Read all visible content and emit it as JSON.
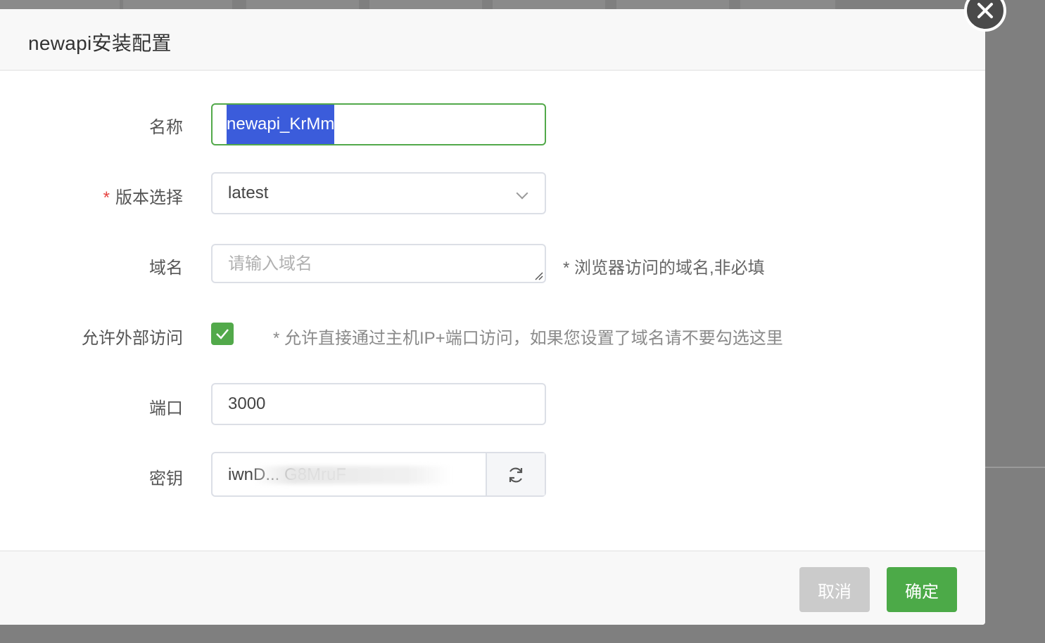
{
  "dialog": {
    "title": "newapi安装配置"
  },
  "form": {
    "name": {
      "label": "名称",
      "value": "newapi_KrMm"
    },
    "version": {
      "label": "版本选择",
      "required_mark": "*",
      "value": "latest"
    },
    "domain": {
      "label": "域名",
      "placeholder": "请输入域名",
      "hint": "* 浏览器访问的域名,非必填"
    },
    "external_access": {
      "label": "允许外部访问",
      "checked": true,
      "hint": "* 允许直接通过主机IP+端口访问，如果您设置了域名请不要勾选这里"
    },
    "port": {
      "label": "端口",
      "value": "3000"
    },
    "secret": {
      "label": "密钥",
      "value": "iwnD... G8MruF"
    }
  },
  "footer": {
    "cancel_label": "取消",
    "ok_label": "确定"
  },
  "colors": {
    "primary": "#4caa48",
    "required": "#e64340",
    "selection": "#3b5cdb"
  },
  "icons": {
    "close": "close-icon",
    "dropdown": "chevron-down-icon",
    "refresh": "refresh-icon",
    "check": "check-icon"
  }
}
